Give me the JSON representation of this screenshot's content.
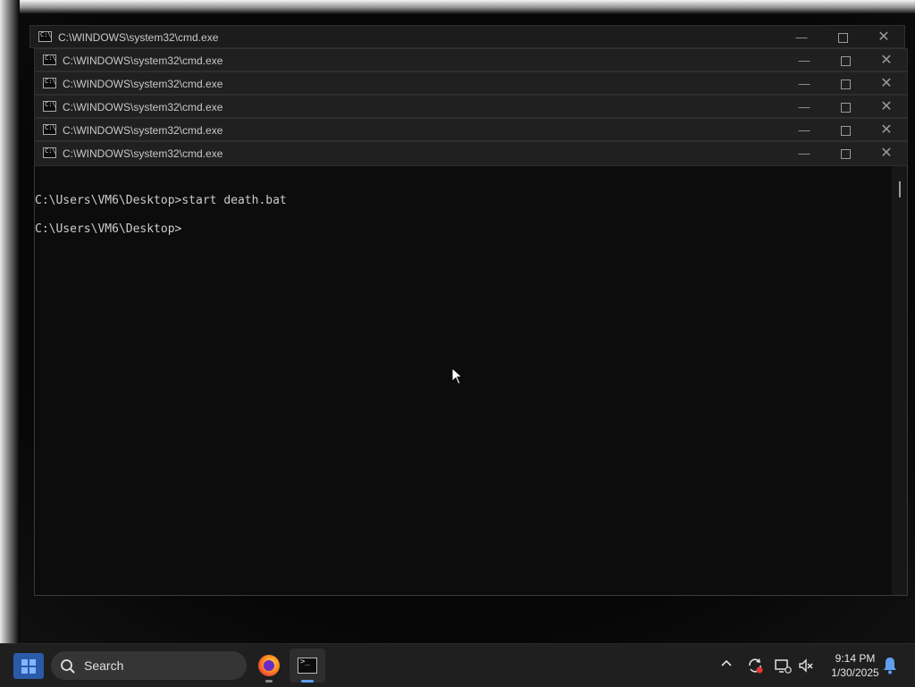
{
  "windows": [
    {
      "title": "C:\\WINDOWS\\system32\\cmd.exe"
    },
    {
      "title": "C:\\WINDOWS\\system32\\cmd.exe"
    },
    {
      "title": "C:\\WINDOWS\\system32\\cmd.exe"
    },
    {
      "title": "C:\\WINDOWS\\system32\\cmd.exe"
    },
    {
      "title": "C:\\WINDOWS\\system32\\cmd.exe"
    },
    {
      "title": "C:\\WINDOWS\\system32\\cmd.exe"
    }
  ],
  "console": {
    "lines": "\nC:\\Users\\VM6\\Desktop>start death.bat\n\nC:\\Users\\VM6\\Desktop>"
  },
  "taskbar": {
    "search_label": "Search",
    "time": "9:14 PM",
    "date": "1/30/2025",
    "apps": [
      "firefox-icon",
      "command-prompt-icon"
    ]
  },
  "colors": {
    "console_bg": "#0c0c0c",
    "titlebar_bg": "#202020",
    "taskbar_bg": "#1f1f1f",
    "accent": "#5ea0ef"
  }
}
